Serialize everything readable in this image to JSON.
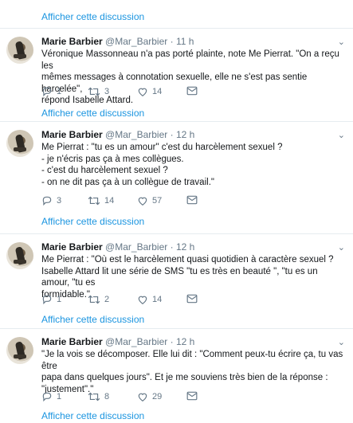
{
  "top": {
    "link": "Afficher cette discussion"
  },
  "author": {
    "name": "Marie Barbier",
    "handle": "@Mar_Barbier",
    "sep": "·"
  },
  "tweets": [
    {
      "time": "11 h",
      "lines": [
        "Véronique Massonneau n'a pas porté plainte, note Me Pierrat. \"On a reçu les",
        "mêmes messages à connotation sexuelle, elle ne s'est pas sentie harcelée\",",
        "répond Isabelle Attard."
      ],
      "replies": "1",
      "retweets": "3",
      "likes": "14",
      "link": "Afficher cette discussion"
    },
    {
      "time": "12 h",
      "lines": [
        "Me Pierrat : \"tu es un amour\" c'est du harcèlement sexuel ?",
        "- je n'écris pas ça à mes collègues.",
        "- c'est du harcèlement sexuel ?",
        "- on ne dit pas ça à un collègue de travail.\""
      ],
      "replies": "3",
      "retweets": "14",
      "likes": "57",
      "link": "Afficher cette discussion"
    },
    {
      "time": "12 h",
      "lines": [
        "Me Pierrat : \"Où est le harcèlement quasi quotidien à caractère sexuel ?",
        "Isabelle Attard lit une série de SMS \"tu es très en beauté \", \"tu es un amour, \"tu es",
        "formidable.\""
      ],
      "replies": "1",
      "retweets": "2",
      "likes": "14",
      "link": "Afficher cette discussion"
    },
    {
      "time": "12 h",
      "lines": [
        "\"Je la vois se décomposer. Elle lui dit : \"Comment peux-tu écrire ça, tu vas être",
        "papa dans quelques jours\". Et je me souviens très bien de la réponse :",
        "\"justement\".\""
      ],
      "replies": "1",
      "retweets": "8",
      "likes": "29",
      "link": "Afficher cette discussion"
    }
  ]
}
